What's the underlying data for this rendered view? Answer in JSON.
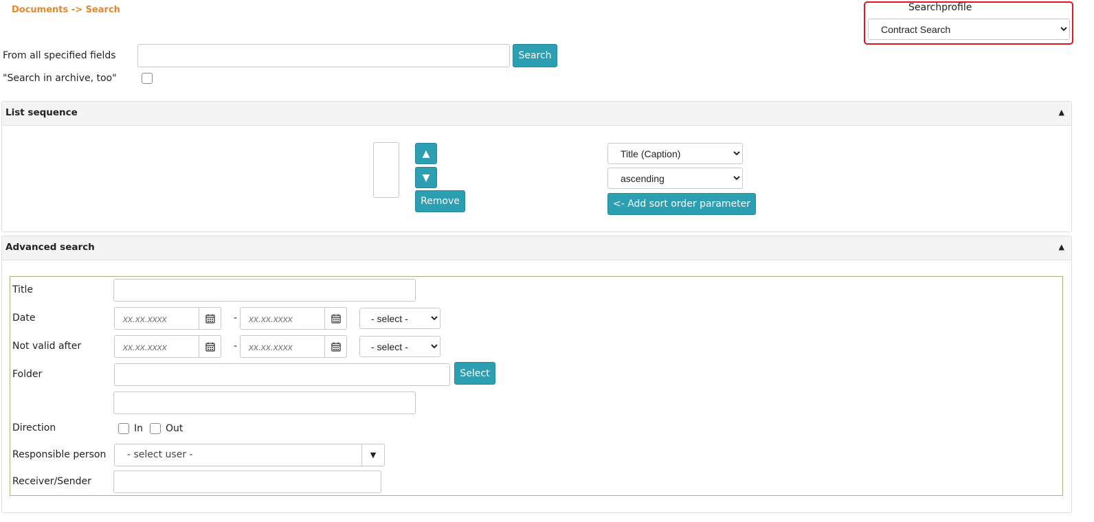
{
  "breadcrumb": "Documents -> Search",
  "searchprofile": {
    "label": "Searchprofile",
    "selected": "Contract Search"
  },
  "quick_search": {
    "label": "From all specified fields",
    "value": "",
    "button": "Search",
    "archive_label": "\"Search in archive, too\""
  },
  "list_sequence": {
    "title": "List sequence",
    "collapse_glyph": "▲",
    "up_glyph": "▲",
    "down_glyph": "▼",
    "remove": "Remove",
    "field_selected": "Title (Caption)",
    "order_selected": "ascending",
    "add_button": "<- Add sort order parameter"
  },
  "advanced": {
    "title": "Advanced search",
    "collapse_glyph": "▲",
    "fields": {
      "title": "Title",
      "date": "Date",
      "not_valid_after": "Not valid after",
      "folder": "Folder",
      "direction": "Direction",
      "responsible": "Responsible person",
      "receiver": "Receiver/Sender"
    },
    "date_placeholder": "xx.xx.xxxx",
    "range_dash": "-",
    "select_placeholder": "- select -",
    "folder_button": "Select",
    "direction_in": "In",
    "direction_out": "Out",
    "user_placeholder": "- select user -",
    "user_arrow": "▼"
  },
  "icons": {
    "calendar": "calendar-icon",
    "collapse": "triangle-up-icon",
    "dropdown": "triangle-down-icon"
  }
}
